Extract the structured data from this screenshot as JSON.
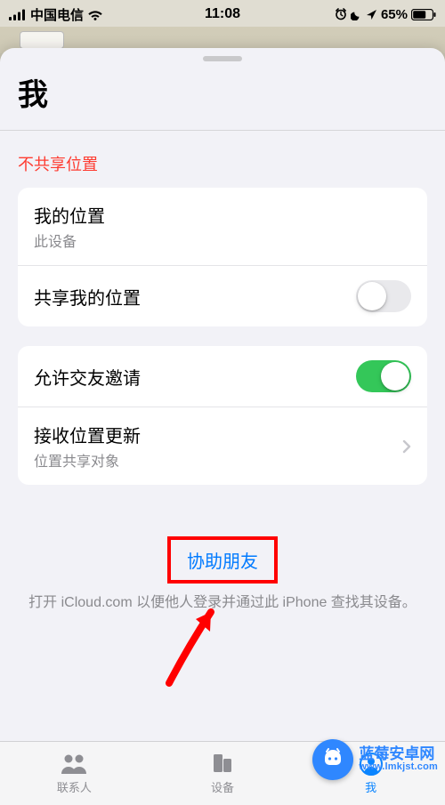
{
  "statusbar": {
    "carrier": "中国电信",
    "time": "11:08",
    "battery_text": "65%"
  },
  "sheet": {
    "title": "我",
    "not_sharing": "不共享位置",
    "my_location": {
      "title": "我的位置",
      "subtitle": "此设备"
    },
    "share_my_location": {
      "title": "共享我的位置",
      "on": false
    },
    "allow_friend_req": {
      "title": "允许交友邀请",
      "on": true
    },
    "receive_updates": {
      "title": "接收位置更新",
      "subtitle": "位置共享对象"
    },
    "help_friend": {
      "link": "协助朋友",
      "subtitle": "打开 iCloud.com 以便他人登录并通过此 iPhone 查找其设备。"
    }
  },
  "tabs": {
    "contacts": "联系人",
    "devices": "设备",
    "me": "我"
  },
  "watermark": {
    "line1": "蓝莓安卓网",
    "line2": "www.lmkjst.com"
  }
}
